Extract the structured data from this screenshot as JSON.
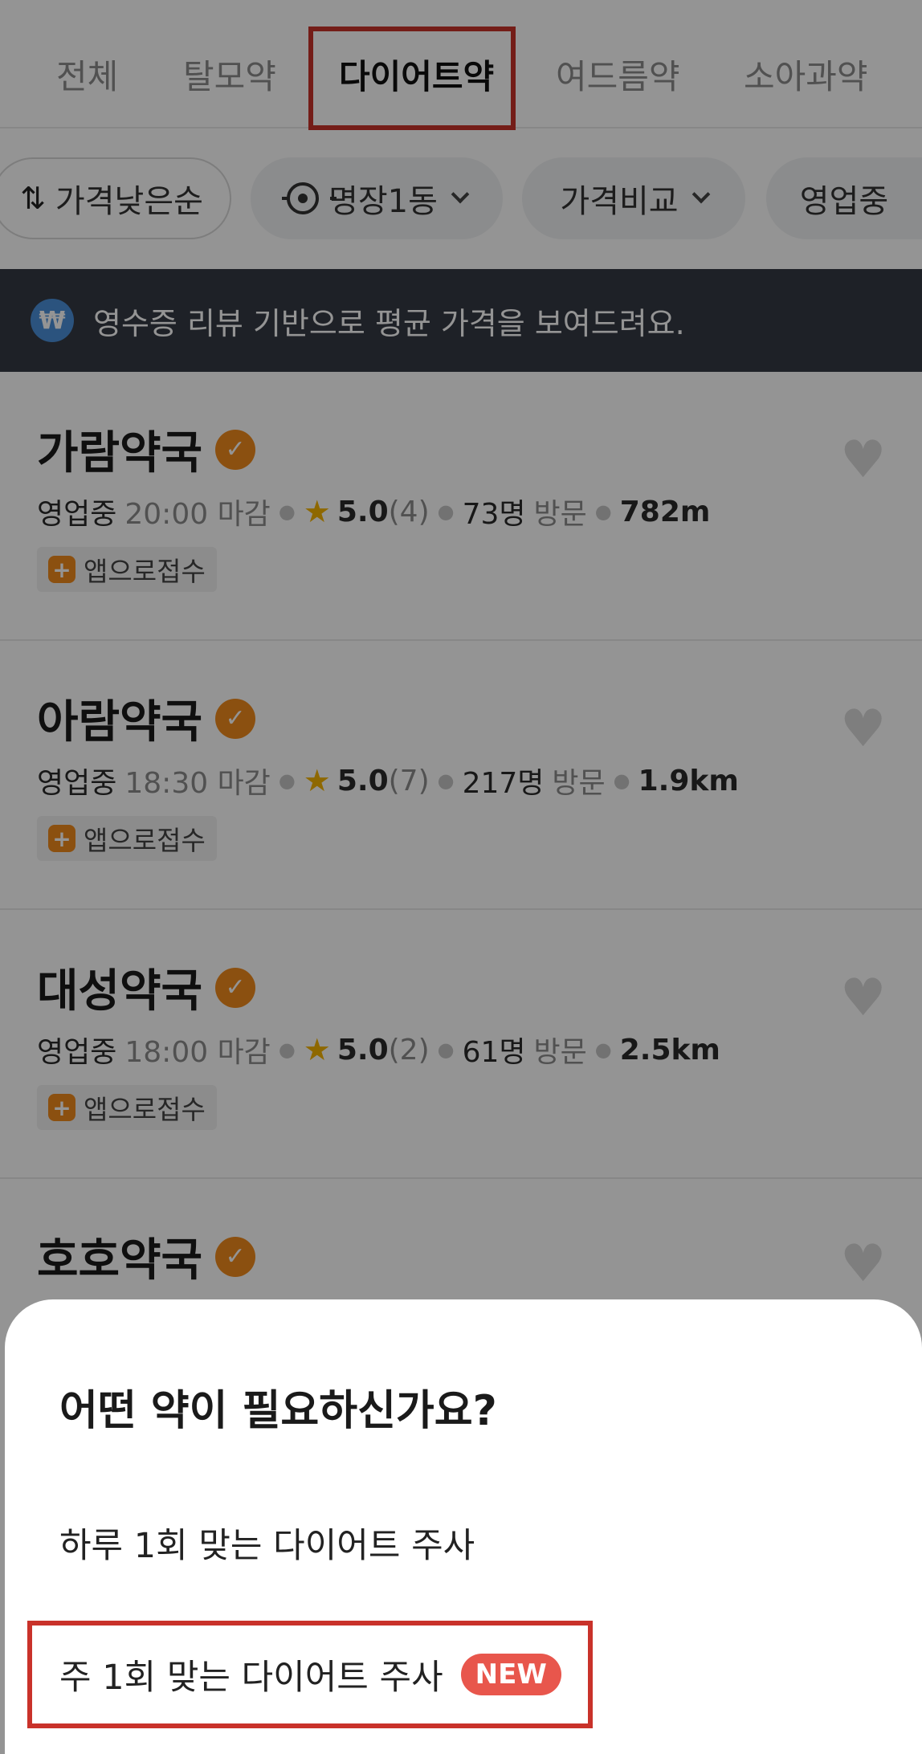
{
  "tabs": {
    "items": [
      "전체",
      "탈모약",
      "다이어트약",
      "여드름약",
      "소아과약"
    ],
    "active_index": 2
  },
  "filters": {
    "sort_label": "가격낮은순",
    "location_label": "명장1동",
    "price_compare_label": "가격비교",
    "open_label": "영업중"
  },
  "banner": {
    "icon_text": "₩",
    "text": "영수증 리뷰 기반으로 평균 가격을 보여드려요."
  },
  "pharmacies": [
    {
      "name": "가람약국",
      "status": "영업중",
      "close": "20:00 마감",
      "rating": "5.0",
      "reviews": "(4)",
      "visits": "73명",
      "visit_label": "방문",
      "distance": "782m",
      "badge": "앱으로접수"
    },
    {
      "name": "아람약국",
      "status": "영업중",
      "close": "18:30 마감",
      "rating": "5.0",
      "reviews": "(7)",
      "visits": "217명",
      "visit_label": "방문",
      "distance": "1.9km",
      "badge": "앱으로접수"
    },
    {
      "name": "대성약국",
      "status": "영업중",
      "close": "18:00 마감",
      "rating": "5.0",
      "reviews": "(2)",
      "visits": "61명",
      "visit_label": "방문",
      "distance": "2.5km",
      "badge": "앱으로접수"
    },
    {
      "name": "호호약국"
    }
  ],
  "sheet": {
    "title": "어떤 약이 필요하신가요?",
    "options": [
      {
        "label": "하루 1회 맞는 다이어트 주사"
      },
      {
        "label": "주 1회 맞는 다이어트 주사",
        "badge": "NEW"
      }
    ]
  },
  "colors": {
    "highlight_red": "#c9322a",
    "banner_bg": "#353a44",
    "verified_orange": "#f08a1c",
    "star_yellow": "#f4b400",
    "new_badge": "#e8564c"
  }
}
